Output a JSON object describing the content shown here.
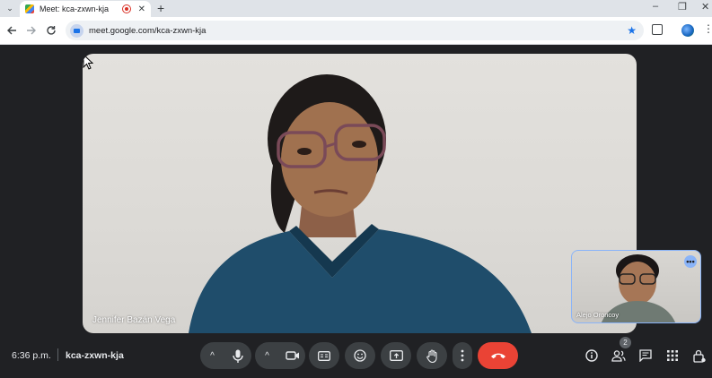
{
  "browser": {
    "tab_title": "Meet: kca-zxwn-kja",
    "tab_close": "✕",
    "new_tab": "+",
    "url": "meet.google.com/kca-zxwn-kja",
    "window_controls": [
      "–",
      "❐",
      "✕"
    ]
  },
  "meeting": {
    "main_participant": "Jennifer Bazán Vega",
    "self_participant": "Alejo Oroncoy",
    "time": "6:36 p.m.",
    "code": "kca-zxwn-kja",
    "participant_count": "2"
  },
  "controls": {
    "mic_chevron": "^",
    "cam_chevron": "^"
  },
  "colors": {
    "end_call": "#ea4335",
    "control_bg": "#3c4043",
    "background": "#202124",
    "accent": "#8ab4f8"
  }
}
